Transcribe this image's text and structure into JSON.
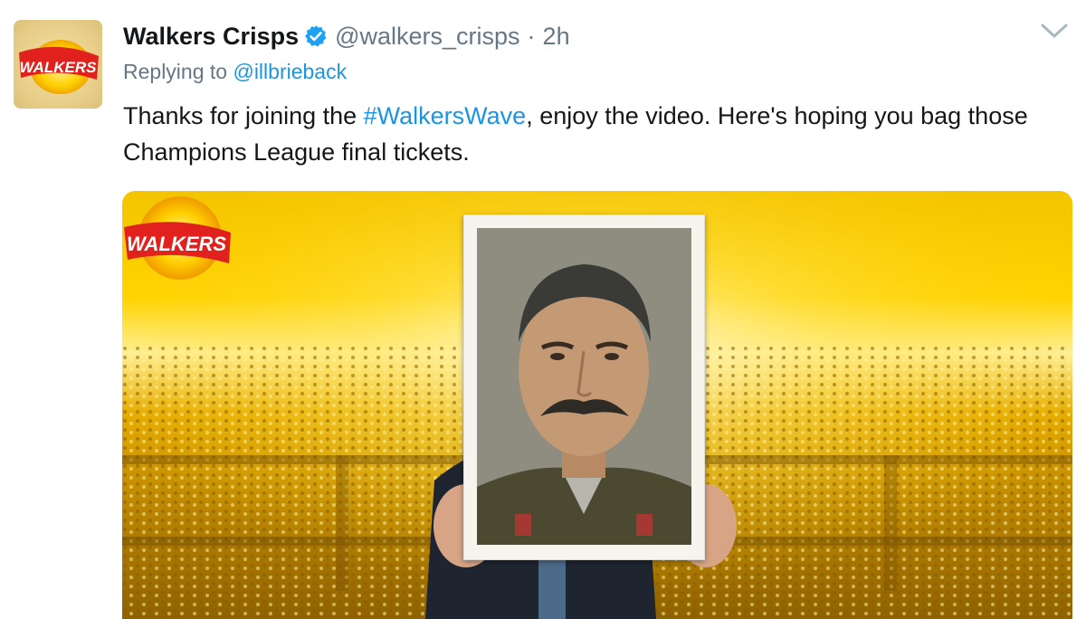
{
  "tweet": {
    "display_name": "Walkers Crisps",
    "handle": "@walkers_crisps",
    "separator": "·",
    "time": "2h",
    "reply_prefix": "Replying to",
    "reply_to": "@illbrieback",
    "text_before": "Thanks for joining the ",
    "hashtag": "#WalkersWave",
    "text_after": ", enjoy the video. Here's hoping you bag those Champions League final tickets."
  },
  "avatar": {
    "logo_text": "WALKERS"
  },
  "media": {
    "logo_text": "WALKERS"
  },
  "colors": {
    "link": "#1b95e0",
    "text": "#14171a",
    "secondary": "#657786",
    "brand_red": "#e0211d",
    "brand_gold": "#ffd400"
  },
  "icons": {
    "verified": "verified-badge-icon",
    "more": "chevron-down-icon"
  }
}
